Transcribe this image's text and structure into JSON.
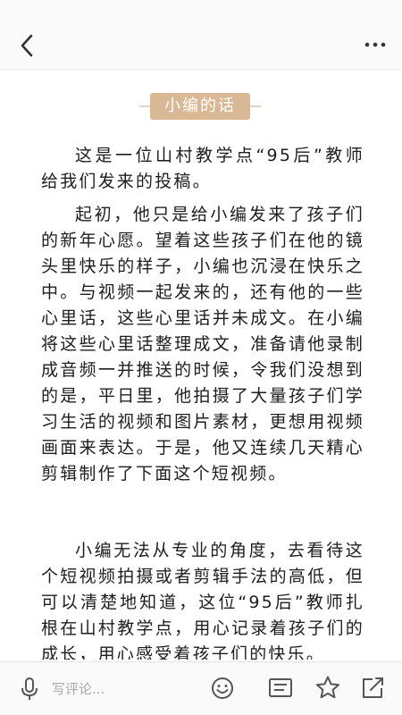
{
  "header": {
    "back_icon": "chevron-left-icon",
    "more_icon": "more-horizontal-icon"
  },
  "article": {
    "section_tag": "小编的话",
    "paragraphs": [
      "这是一位山村教学点“95后”教师给我们发来的投稿。",
      "起初，他只是给小编发来了孩子们的新年心愿。望着这些孩子们在他的镜头里快乐的样子，小编也沉浸在快乐之中。与视频一起发来的，还有他的一些心里话，这些心里话并未成文。在小编将这些心里话整理成文，准备请他录制成音频一并推送的时候，令我们没想到的是，平日里，他拍摄了大量孩子们学习生活的视频和图片素材，更想用视频画面来表达。于是，他又连续几天精心剪辑制作了下面这个短视频。",
      "小编无法从专业的角度，去看待这个短视频拍摄或者剪辑手法的高低，但可以清楚地知道，这位“95后”教师扎根在山村教学点，用心记录着孩子们的成长，用心感受着孩子们的快乐。"
    ]
  },
  "bottom_bar": {
    "comment_placeholder": "写评论...",
    "icons": [
      "microphone-icon",
      "emoji-icon",
      "comments-icon",
      "star-icon",
      "share-icon"
    ]
  },
  "colors": {
    "tag_background": "#d9b895",
    "bar_background": "#fafafa",
    "icon_color": "#555555"
  }
}
